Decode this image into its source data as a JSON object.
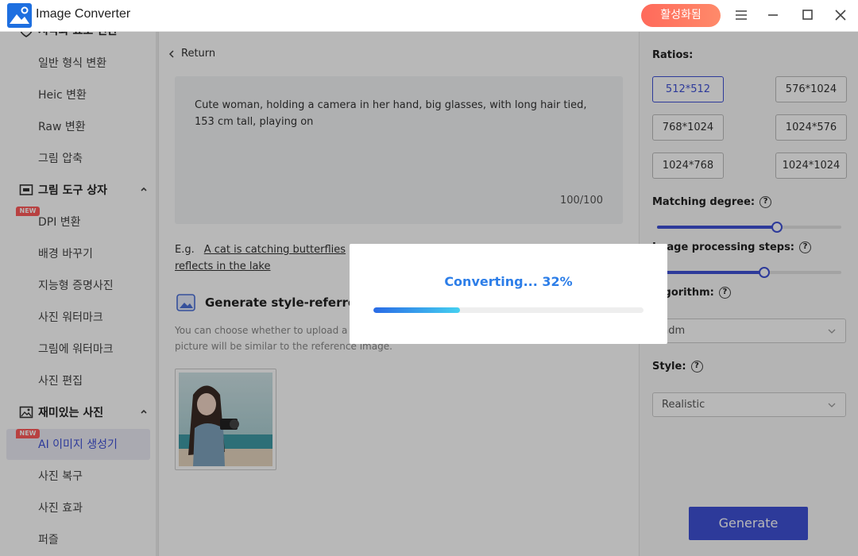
{
  "app": {
    "title": "Image Converter",
    "activate_label": "활성화됨"
  },
  "sidebar": {
    "top_partial_label": "시각화 요소 변환",
    "items_group1": [
      "일반 형식 변환",
      "Heic 변환",
      "Raw 변환",
      "그림 압축"
    ],
    "section2": {
      "title": "그림 도구 상자"
    },
    "items_group2": [
      "DPI 변환",
      "배경 바꾸기",
      "지능형 증명사진",
      "사진 워터마크",
      "그림에 워터마크",
      "사진 편집"
    ],
    "section3": {
      "title": "재미있는 사진"
    },
    "items_group3": [
      "AI 이미지 생성기",
      "사진 복구",
      "사진 효과",
      "퍼즐"
    ],
    "new_badge": "NEW"
  },
  "main": {
    "return_label": "Return",
    "prompt_text": "Cute woman, holding a camera in her hand, big glasses, with long hair tied, 153 cm tall, playing on",
    "prompt_count": "100/100",
    "eg_label": "E.g.",
    "eg_link1": "A cat is catching butterflies",
    "eg_link2": "reflects in the lake",
    "gen_title": "Generate style-referred pi",
    "gen_desc_line1": "You can choose whether to upload a p",
    "gen_desc_line2": "picture will be similar to the reference image."
  },
  "right_panel": {
    "ratios_label": "Ratios:",
    "ratios": [
      "512*512",
      "576*1024",
      "768*1024",
      "1024*576",
      "1024*768",
      "1024*1024"
    ],
    "selected_ratio": "512*512",
    "matching_label": "Matching degree:",
    "matching_value": 0.65,
    "steps_label": "Image processing steps:",
    "steps_label_visible": "age processing steps:",
    "steps_value": 0.58,
    "algorithm_label": "Algorithm:",
    "algorithm_label_visible": "gorithm:",
    "algorithm_value": "ndm",
    "style_label": "Style:",
    "style_value": "Realistic",
    "generate_label": "Generate",
    "help_glyph": "?"
  },
  "dialog": {
    "status_text": "Converting... 32%",
    "progress": 0.32
  },
  "colors": {
    "accent": "#3f51d6",
    "progress_blue": "#2d7ee8",
    "activate_red": "#ff6a5b",
    "new_badge": "#ff5a5a"
  }
}
